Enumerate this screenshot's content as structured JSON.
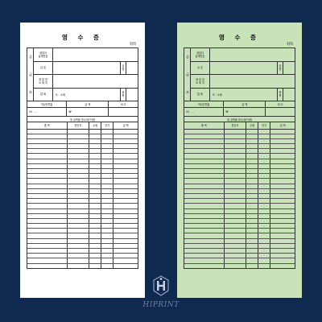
{
  "colors": {
    "background": "#10294f",
    "paper_white": "#ffffff",
    "paper_green": "#c8e3b9",
    "line": "#333333"
  },
  "receipt": {
    "title": "영 수 증",
    "recipient_suffix": "귀하",
    "supplier_side_labels": [
      "공",
      "급",
      "자"
    ],
    "reg_no_label_1": "영업자",
    "reg_no_label_2": "납세번호",
    "name_label": "상    호",
    "owner_label_1": "성",
    "owner_label_2": "명",
    "address_label_1": "영 업 장",
    "address_label_2": "소 재 지",
    "business_label": "업    태",
    "business_sep": "도 · 소매",
    "item_label_1": "종",
    "item_label_2": "목",
    "date_header": "작성년월일",
    "amount_header": "금    액",
    "remarks_header": "비    고",
    "date_value": "20 .  .  .",
    "currency_sign": "₩",
    "note": "위 금액을 영수(청구)함",
    "col_item": "품    목",
    "col_qty_unit": "원산지",
    "col_qty": "수량",
    "col_price": "단가",
    "col_amount": "금    액",
    "blank_row_count": 28
  },
  "logo": {
    "text": "HIPRINT",
    "icon": "hiprint-logo-icon"
  }
}
